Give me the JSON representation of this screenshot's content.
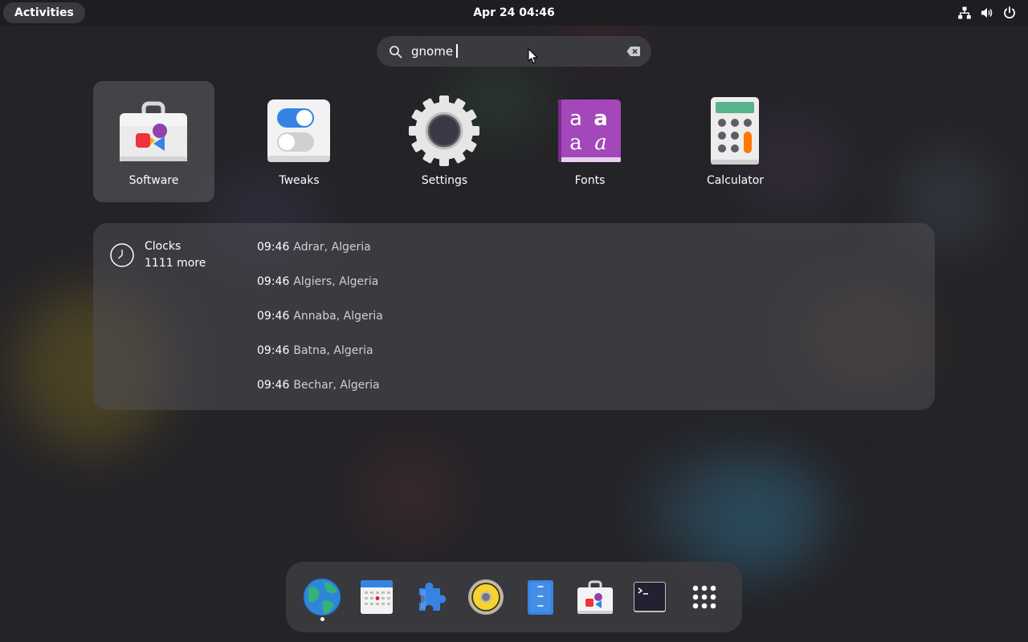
{
  "topbar": {
    "activities_label": "Activities",
    "clock_text": "Apr 24  04:46",
    "tray_icons": [
      "network-wired-icon",
      "volume-icon",
      "power-icon"
    ]
  },
  "search": {
    "query": "gnome",
    "icon": "search-icon",
    "clear_icon": "clear-text-icon"
  },
  "app_results": [
    {
      "label": "Software",
      "icon": "software-icon",
      "selected": true
    },
    {
      "label": "Tweaks",
      "icon": "tweaks-icon",
      "selected": false
    },
    {
      "label": "Settings",
      "icon": "settings-gear-icon",
      "selected": false
    },
    {
      "label": "Fonts",
      "icon": "fonts-icon",
      "selected": false
    },
    {
      "label": "Calculator",
      "icon": "calculator-icon",
      "selected": false
    }
  ],
  "clocks": {
    "provider_name": "Clocks",
    "more_label": "1111 more",
    "icon": "clock-icon",
    "results": [
      {
        "time": "09:46",
        "city": "Adrar, Algeria"
      },
      {
        "time": "09:46",
        "city": "Algiers, Algeria"
      },
      {
        "time": "09:46",
        "city": "Annaba, Algeria"
      },
      {
        "time": "09:46",
        "city": "Batna, Algeria"
      },
      {
        "time": "09:46",
        "city": "Bechar, Algeria"
      }
    ]
  },
  "dock": {
    "items": [
      {
        "icon": "web-browser-icon",
        "running": true
      },
      {
        "icon": "calendar-icon",
        "running": false
      },
      {
        "icon": "extensions-icon",
        "running": false
      },
      {
        "icon": "music-player-icon",
        "running": false
      },
      {
        "icon": "text-editor-icon",
        "running": false
      },
      {
        "icon": "software-icon",
        "running": false
      },
      {
        "icon": "terminal-icon",
        "running": false
      },
      {
        "icon": "show-apps-grid-icon",
        "running": false
      }
    ]
  },
  "colors": {
    "background": "#242327",
    "topbar": "#1e1d21",
    "search_bg": "#3b3a3f",
    "fonts_purple": "#a347ba",
    "calculator_orange": "#ff7800",
    "tweaks_blue": "#3584e4"
  }
}
